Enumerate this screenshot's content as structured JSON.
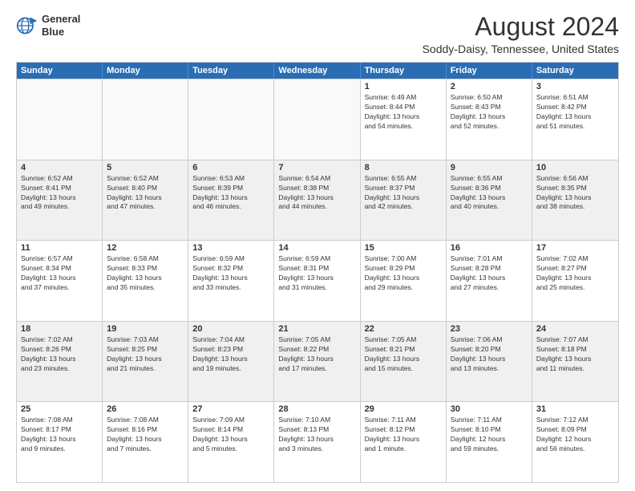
{
  "logo": {
    "line1": "General",
    "line2": "Blue"
  },
  "title": "August 2024",
  "subtitle": "Soddy-Daisy, Tennessee, United States",
  "headers": [
    "Sunday",
    "Monday",
    "Tuesday",
    "Wednesday",
    "Thursday",
    "Friday",
    "Saturday"
  ],
  "rows": [
    [
      {
        "day": "",
        "text": "",
        "empty": true
      },
      {
        "day": "",
        "text": "",
        "empty": true
      },
      {
        "day": "",
        "text": "",
        "empty": true
      },
      {
        "day": "",
        "text": "",
        "empty": true
      },
      {
        "day": "1",
        "text": "Sunrise: 6:49 AM\nSunset: 8:44 PM\nDaylight: 13 hours\nand 54 minutes."
      },
      {
        "day": "2",
        "text": "Sunrise: 6:50 AM\nSunset: 8:43 PM\nDaylight: 13 hours\nand 52 minutes."
      },
      {
        "day": "3",
        "text": "Sunrise: 6:51 AM\nSunset: 8:42 PM\nDaylight: 13 hours\nand 51 minutes."
      }
    ],
    [
      {
        "day": "4",
        "text": "Sunrise: 6:52 AM\nSunset: 8:41 PM\nDaylight: 13 hours\nand 49 minutes."
      },
      {
        "day": "5",
        "text": "Sunrise: 6:52 AM\nSunset: 8:40 PM\nDaylight: 13 hours\nand 47 minutes."
      },
      {
        "day": "6",
        "text": "Sunrise: 6:53 AM\nSunset: 8:39 PM\nDaylight: 13 hours\nand 46 minutes."
      },
      {
        "day": "7",
        "text": "Sunrise: 6:54 AM\nSunset: 8:38 PM\nDaylight: 13 hours\nand 44 minutes."
      },
      {
        "day": "8",
        "text": "Sunrise: 6:55 AM\nSunset: 8:37 PM\nDaylight: 13 hours\nand 42 minutes."
      },
      {
        "day": "9",
        "text": "Sunrise: 6:55 AM\nSunset: 8:36 PM\nDaylight: 13 hours\nand 40 minutes."
      },
      {
        "day": "10",
        "text": "Sunrise: 6:56 AM\nSunset: 8:35 PM\nDaylight: 13 hours\nand 38 minutes."
      }
    ],
    [
      {
        "day": "11",
        "text": "Sunrise: 6:57 AM\nSunset: 8:34 PM\nDaylight: 13 hours\nand 37 minutes."
      },
      {
        "day": "12",
        "text": "Sunrise: 6:58 AM\nSunset: 8:33 PM\nDaylight: 13 hours\nand 35 minutes."
      },
      {
        "day": "13",
        "text": "Sunrise: 6:59 AM\nSunset: 8:32 PM\nDaylight: 13 hours\nand 33 minutes."
      },
      {
        "day": "14",
        "text": "Sunrise: 6:59 AM\nSunset: 8:31 PM\nDaylight: 13 hours\nand 31 minutes."
      },
      {
        "day": "15",
        "text": "Sunrise: 7:00 AM\nSunset: 8:29 PM\nDaylight: 13 hours\nand 29 minutes."
      },
      {
        "day": "16",
        "text": "Sunrise: 7:01 AM\nSunset: 8:28 PM\nDaylight: 13 hours\nand 27 minutes."
      },
      {
        "day": "17",
        "text": "Sunrise: 7:02 AM\nSunset: 8:27 PM\nDaylight: 13 hours\nand 25 minutes."
      }
    ],
    [
      {
        "day": "18",
        "text": "Sunrise: 7:02 AM\nSunset: 8:26 PM\nDaylight: 13 hours\nand 23 minutes."
      },
      {
        "day": "19",
        "text": "Sunrise: 7:03 AM\nSunset: 8:25 PM\nDaylight: 13 hours\nand 21 minutes."
      },
      {
        "day": "20",
        "text": "Sunrise: 7:04 AM\nSunset: 8:23 PM\nDaylight: 13 hours\nand 19 minutes."
      },
      {
        "day": "21",
        "text": "Sunrise: 7:05 AM\nSunset: 8:22 PM\nDaylight: 13 hours\nand 17 minutes."
      },
      {
        "day": "22",
        "text": "Sunrise: 7:05 AM\nSunset: 8:21 PM\nDaylight: 13 hours\nand 15 minutes."
      },
      {
        "day": "23",
        "text": "Sunrise: 7:06 AM\nSunset: 8:20 PM\nDaylight: 13 hours\nand 13 minutes."
      },
      {
        "day": "24",
        "text": "Sunrise: 7:07 AM\nSunset: 8:18 PM\nDaylight: 13 hours\nand 11 minutes."
      }
    ],
    [
      {
        "day": "25",
        "text": "Sunrise: 7:08 AM\nSunset: 8:17 PM\nDaylight: 13 hours\nand 9 minutes."
      },
      {
        "day": "26",
        "text": "Sunrise: 7:08 AM\nSunset: 8:16 PM\nDaylight: 13 hours\nand 7 minutes."
      },
      {
        "day": "27",
        "text": "Sunrise: 7:09 AM\nSunset: 8:14 PM\nDaylight: 13 hours\nand 5 minutes."
      },
      {
        "day": "28",
        "text": "Sunrise: 7:10 AM\nSunset: 8:13 PM\nDaylight: 13 hours\nand 3 minutes."
      },
      {
        "day": "29",
        "text": "Sunrise: 7:11 AM\nSunset: 8:12 PM\nDaylight: 13 hours\nand 1 minute."
      },
      {
        "day": "30",
        "text": "Sunrise: 7:11 AM\nSunset: 8:10 PM\nDaylight: 12 hours\nand 59 minutes."
      },
      {
        "day": "31",
        "text": "Sunrise: 7:12 AM\nSunset: 8:09 PM\nDaylight: 12 hours\nand 56 minutes."
      }
    ]
  ]
}
